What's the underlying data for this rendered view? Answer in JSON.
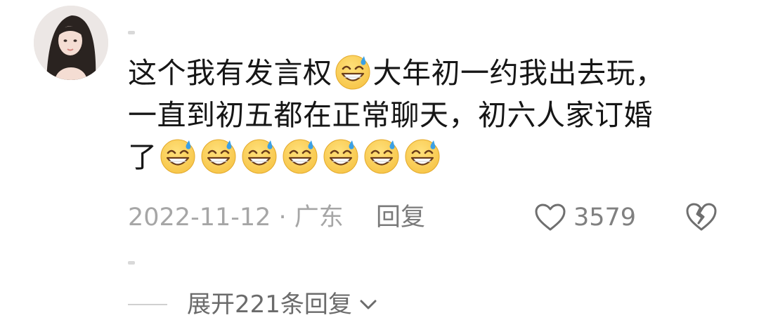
{
  "comment": {
    "segments_line1": [
      "这个我有发言权",
      "大年初一约我出去玩，"
    ],
    "line2": "一直到初五都在正常聊天，初六人家订婚",
    "line3_text": "了",
    "line3_emoji_count": 7,
    "emoji_icon": "grinning-sweat-emoji-icon"
  },
  "meta": {
    "date_location": "2022-11-12 · 广东",
    "reply_label": "回复"
  },
  "actions": {
    "like_icon": "heart-outline-icon",
    "like_count": "3579",
    "dislike_icon": "broken-heart-icon"
  },
  "replies": {
    "expand_label": "展开221条回复",
    "chevron_icon": "chevron-down-icon"
  },
  "colors": {
    "text_primary": "#161616",
    "text_meta": "#a6a6a6",
    "text_reply": "#7a7a7a",
    "emoji_face": "#f7c64a",
    "emoji_sweat": "#3aa0e6"
  }
}
